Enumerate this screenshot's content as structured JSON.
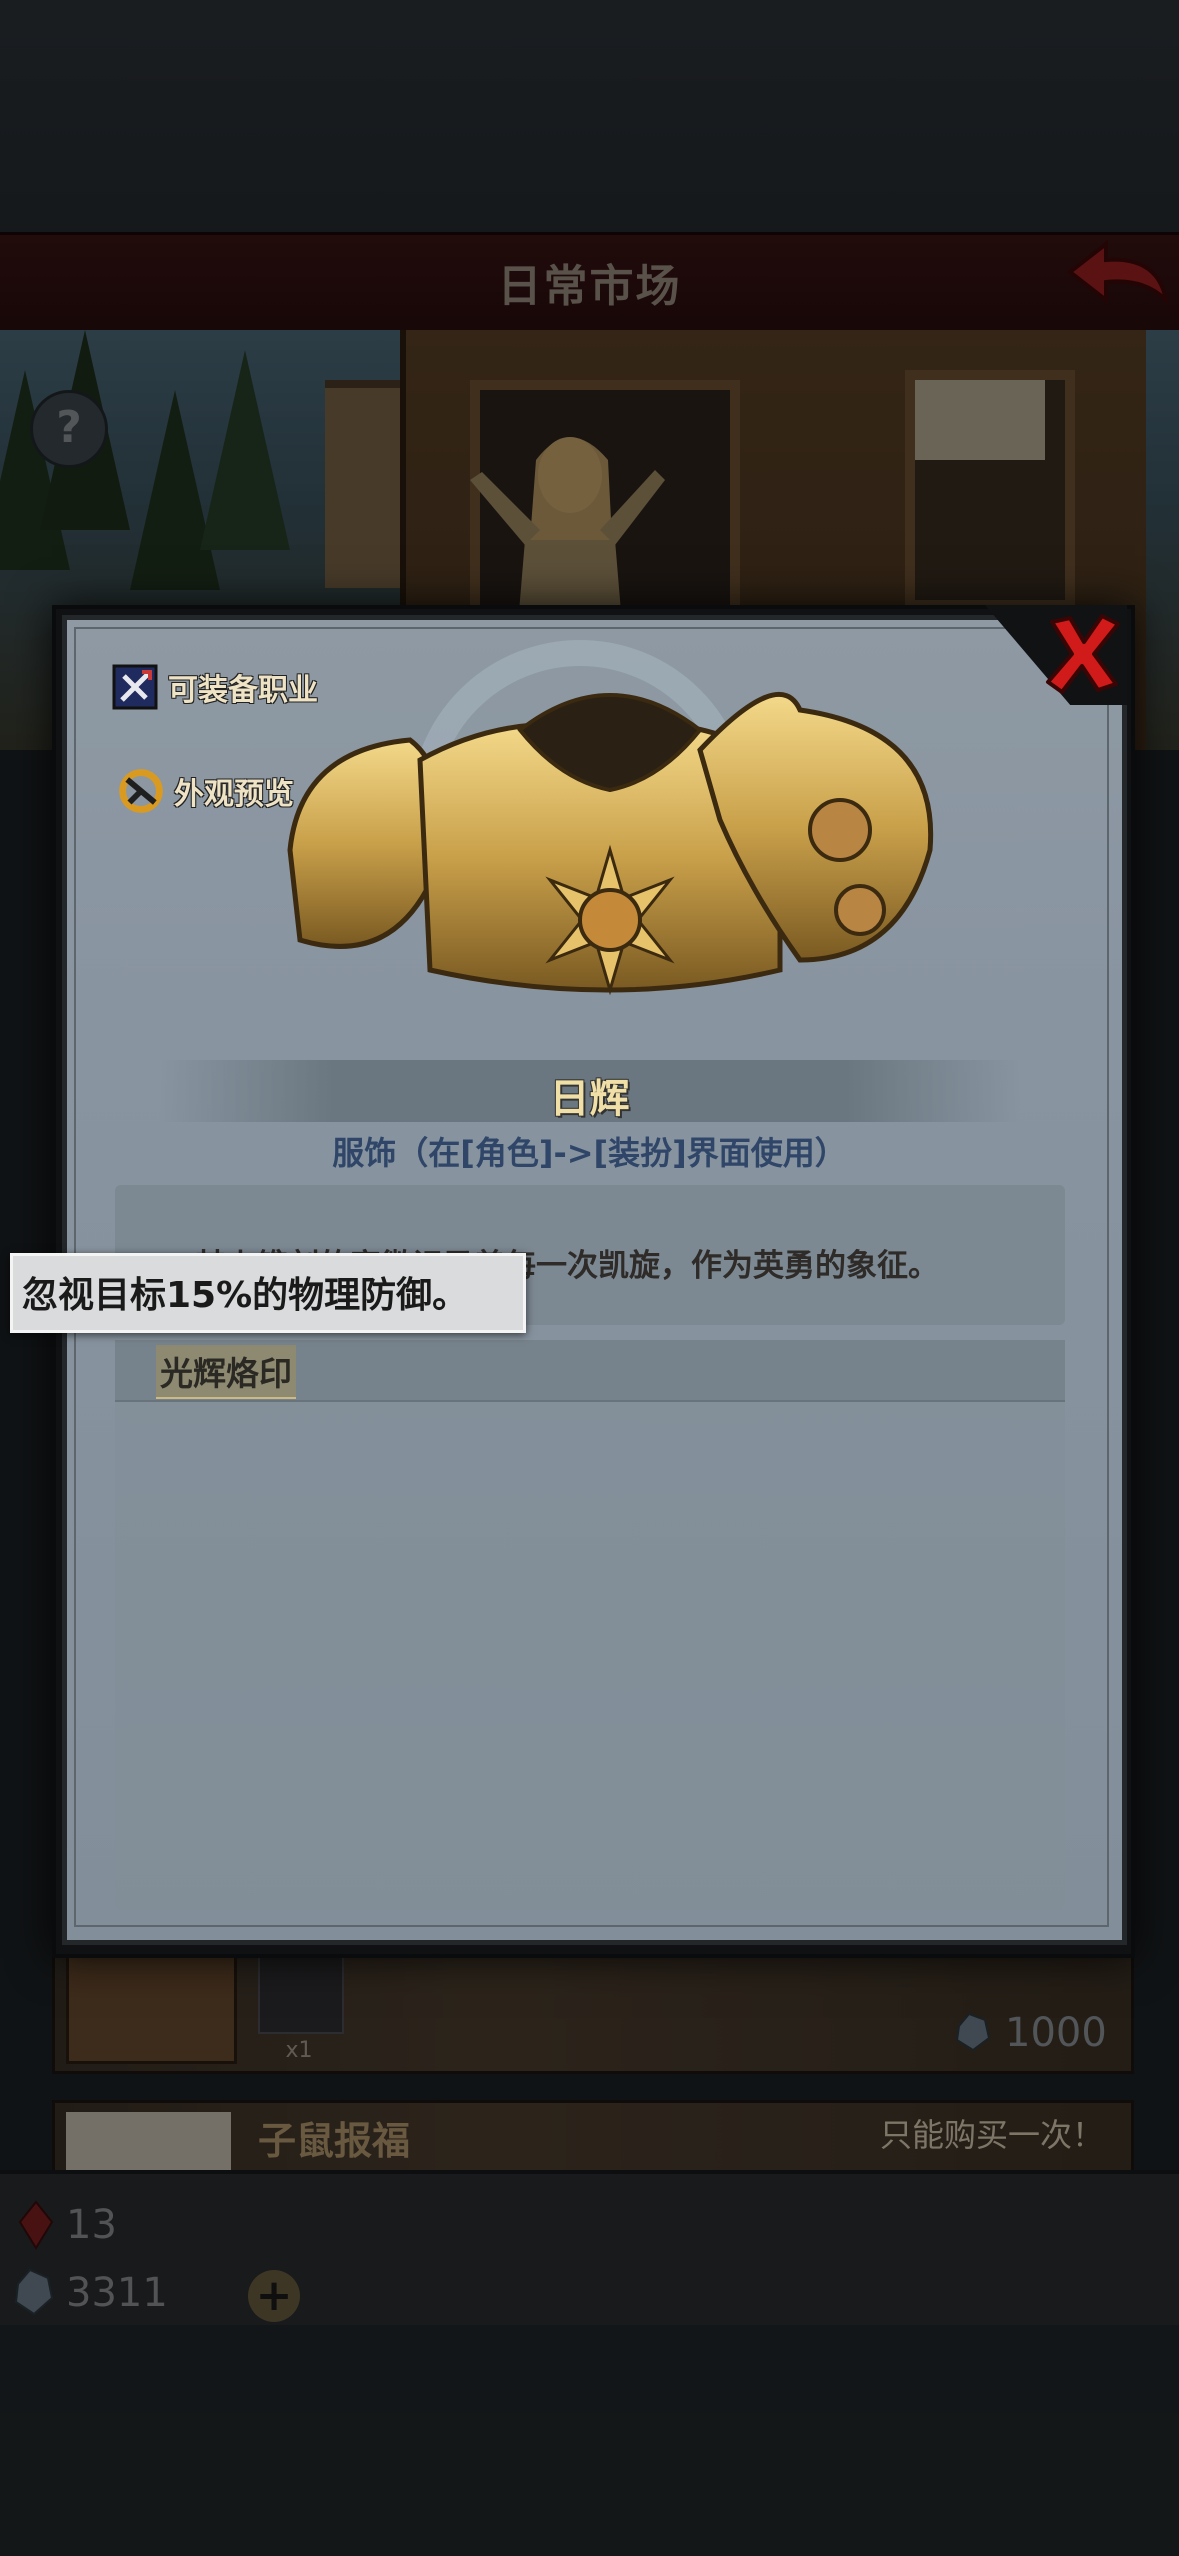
{
  "header": {
    "title": "日常市场"
  },
  "modal": {
    "side_links": {
      "equip_classes": "可装备职业",
      "appearance_preview": "外观预览"
    },
    "item": {
      "name": "日辉",
      "subtitle": "服饰（在[角色]->[装扮]界面使用）",
      "description": "其上镌刻的家徽记录着每一次凯旋，作为英勇的象征。"
    },
    "effect_tab": "光辉烙印",
    "tooltip": "忽视目标15%的物理防御。"
  },
  "background_list": {
    "card1": {
      "quantity": "x1",
      "price": "1000"
    },
    "card2": {
      "title": "子鼠报福",
      "note": "只能购买一次！"
    }
  },
  "currency": {
    "red_gems": "13",
    "blue_gems": "3311"
  },
  "icons": [
    "help-icon",
    "back-arrow-icon",
    "close-icon",
    "equip-classes-icon",
    "appearance-icon",
    "red-gem-icon",
    "blue-gem-icon",
    "plus-icon"
  ],
  "colors": {
    "header_bar": "#3a1414",
    "modal_panel": "#8e99a3",
    "item_name": "#f0dfa6",
    "subtitle": "#2f4669",
    "close_x": "#d11a1a"
  }
}
